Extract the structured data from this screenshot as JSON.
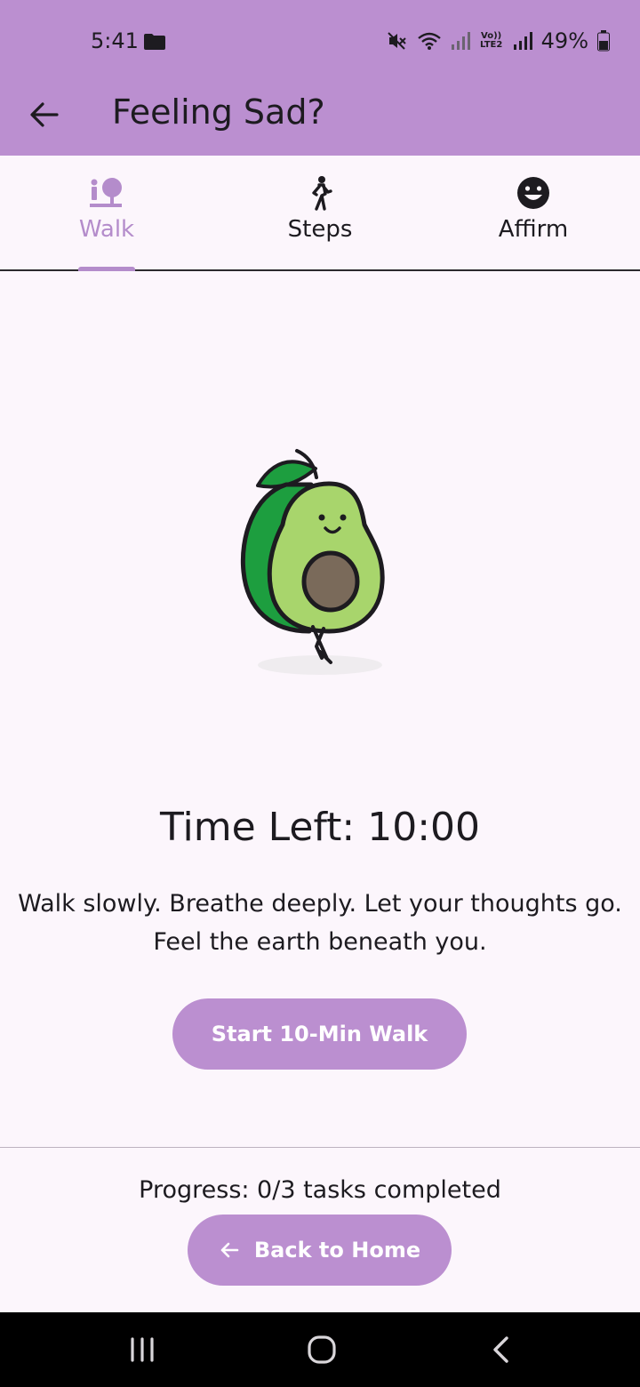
{
  "status_bar": {
    "time": "5:41",
    "lte_label": "Vo)) LTE2",
    "battery": "49%"
  },
  "app_bar": {
    "title": "Feeling Sad?"
  },
  "tabs": [
    {
      "label": "Walk",
      "icon": "walk-tree-icon",
      "active": true
    },
    {
      "label": "Steps",
      "icon": "pedestrian-icon",
      "active": false
    },
    {
      "label": "Affirm",
      "icon": "smiley-icon",
      "active": false
    }
  ],
  "walk": {
    "illustration": "walking-avocado",
    "time_left": "Time Left: 10:00",
    "message_line1": "Walk slowly. Breathe deeply. Let your thoughts go.",
    "message_line2": "Feel the earth beneath you.",
    "start_button": "Start 10-Min Walk"
  },
  "footer": {
    "progress": "Progress: 0/3 tasks completed",
    "home_button": "Back to Home"
  },
  "colors": {
    "accent": "#bb8fd0",
    "active_tab": "#b48ccb",
    "background": "#fcf6fc"
  }
}
